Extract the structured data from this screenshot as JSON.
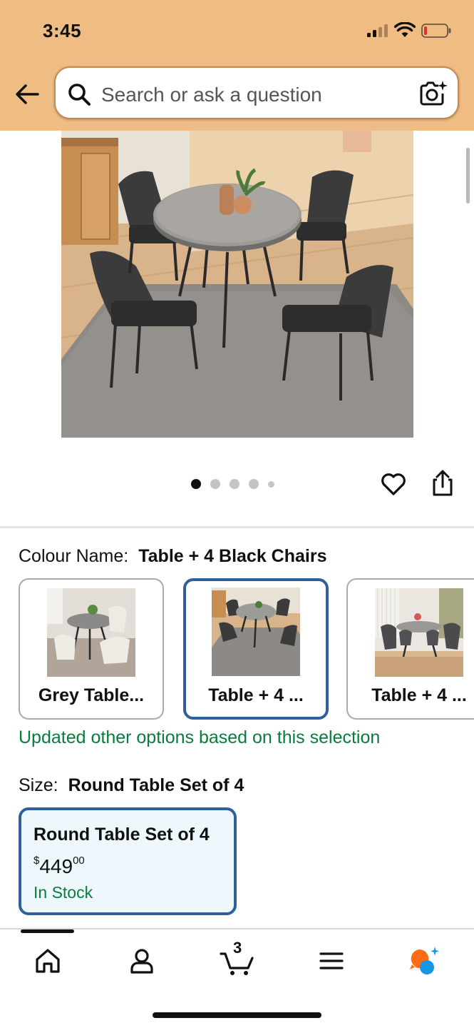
{
  "status_bar": {
    "time": "3:45"
  },
  "search": {
    "placeholder": "Search or ask a question"
  },
  "gallery": {
    "image_count": 5,
    "active_index": 0
  },
  "colour": {
    "label": "Colour Name:",
    "value": "Table + 4 Black Chairs",
    "options": [
      {
        "label": "Grey Table...",
        "selected": false
      },
      {
        "label": "Table + 4 ...",
        "selected": true
      },
      {
        "label": "Table + 4 ...",
        "selected": false
      }
    ],
    "update_note": "Updated other options based on this selection"
  },
  "size": {
    "label": "Size:",
    "value": "Round Table Set of 4",
    "card": {
      "title": "Round Table Set of 4",
      "currency": "$",
      "price_whole": "449",
      "price_fraction": "00",
      "stock": "In Stock"
    }
  },
  "nav": {
    "items": [
      "home-icon",
      "account-icon",
      "cart-icon",
      "menu-icon",
      "rufus-icon"
    ],
    "cart_count": "3",
    "active": "home"
  },
  "colors": {
    "header_bg": "#efbd83",
    "selected_border": "#2e6199",
    "in_stock_green": "#067d3a",
    "selected_card_bg": "#edf7fc"
  }
}
